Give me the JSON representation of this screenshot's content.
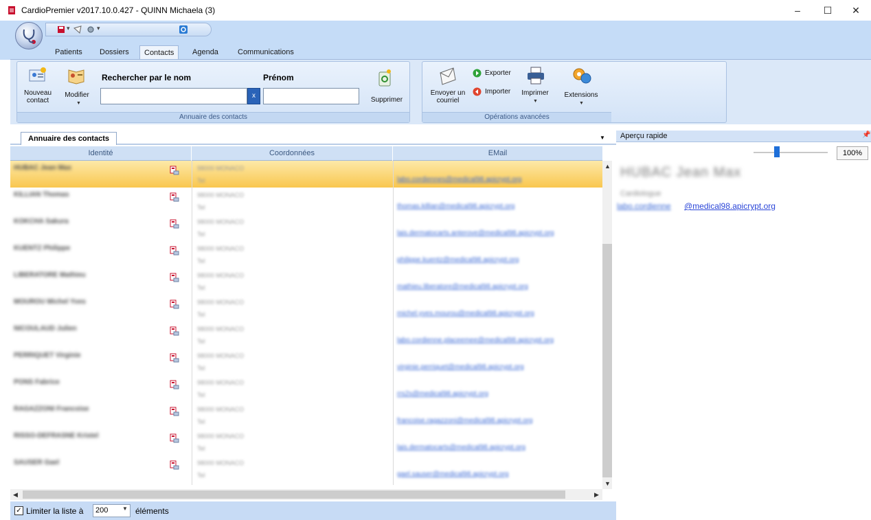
{
  "window": {
    "title": "CardioPremier v2017.10.0.427 - QUINN Michaela (3)",
    "minimize": "–",
    "maximize": "☐",
    "close": "✕"
  },
  "ribbon": {
    "tabs": [
      "Patients",
      "Dossiers",
      "Contacts",
      "Agenda",
      "Communications"
    ],
    "active_tab": "Contacts",
    "group_annuaire": {
      "label": "Annuaire des contacts",
      "nouveau_contact": "Nouveau contact",
      "modifier": "Modifier",
      "search_name_label": "Rechercher par le nom",
      "search_firstname_label": "Prénom",
      "search_name_value": "",
      "search_firstname_value": "",
      "clear": "x",
      "supprimer": "Supprimer"
    },
    "group_operations": {
      "label": "Opérations avancées",
      "envoyer_courriel": "Envoyer un courriel",
      "exporter": "Exporter",
      "importer": "Importer",
      "imprimer": "Imprimer",
      "extensions": "Extensions"
    }
  },
  "contacts_panel": {
    "tab_label": "Annuaire des contacts",
    "columns": [
      "Identité",
      "Coordonnées",
      "EMail"
    ],
    "rows": [
      {
        "name": "HUBAC Jean Max",
        "addr1": "98000 MONACO",
        "addr2": "Tel",
        "email": "labo.cordiennes@medical98.apicrypt.org",
        "selected": true
      },
      {
        "name": "KILLIAN Thomas",
        "addr1": "98000 MONACO",
        "addr2": "Tel",
        "email": "thomas.killian@medical98.apicrypt.org",
        "selected": false
      },
      {
        "name": "KOKCHA Sakura",
        "addr1": "98000 MONACO",
        "addr2": "Tel",
        "email": "lais.dermatocarts.anterove@medical98.apicrypt.org",
        "selected": false
      },
      {
        "name": "KUENTZ Philippe",
        "addr1": "98000 MONACO",
        "addr2": "Tel",
        "email": "philippe.kuentz@medical98.apicrypt.org",
        "selected": false
      },
      {
        "name": "LIBERATORE Mathieu",
        "addr1": "98000 MONACO",
        "addr2": "Tel",
        "email": "mathieu.liberatore@medical98.apicrypt.org",
        "selected": false
      },
      {
        "name": "MOUROU Michel Yves",
        "addr1": "98000 MONACO",
        "addr2": "Tel",
        "email": "michel.yves.mourou@medical98.apicrypt.org",
        "selected": false
      },
      {
        "name": "NICOULAUD Julien",
        "addr1": "98000 MONACO",
        "addr2": "Tel",
        "email": "labo.cordienne.placeemee@medical98.apicrypt.org",
        "selected": false
      },
      {
        "name": "PERRIQUET Virginie",
        "addr1": "98000 MONACO",
        "addr2": "Tel",
        "email": "virginie.perriquet@medical98.apicrypt.org",
        "selected": false
      },
      {
        "name": "PONS Fabrice",
        "addr1": "98000 MONACO",
        "addr2": "Tel",
        "email": "rrs2s@medical98.apicrypt.org",
        "selected": false
      },
      {
        "name": "RAGAZZONI Francoise",
        "addr1": "98000 MONACO",
        "addr2": "Tel",
        "email": "francoise.ragazzoni@medical98.apicrypt.org",
        "selected": false
      },
      {
        "name": "RISSO-DEFRASNE Kristel",
        "addr1": "98000 MONACO",
        "addr2": "Tel",
        "email": "lais.dermatocarts@medical98.apicrypt.org",
        "selected": false
      },
      {
        "name": "SAUSER Gael",
        "addr1": "98000 MONACO",
        "addr2": "Tel",
        "email": "gael.sauser@medical98.apicrypt.org",
        "selected": false
      }
    ],
    "footer": {
      "limit_label": "Limiter la liste à",
      "limit_value": "200",
      "limit_suffix": "éléments",
      "checked": true
    }
  },
  "preview_panel": {
    "title": "Aperçu rapide",
    "zoom": "100%",
    "zoom_level": 0.3,
    "name": "HUBAC Jean Max",
    "subtitle": "Cardiologue",
    "email_prefix": "labo.cordienne",
    "email_visible": "@medical98.apicrypt.org"
  },
  "colors": {
    "ribbon_bg": "#c5dcf7",
    "selected_row": "#f9c74f",
    "link": "#3d6bd6",
    "accent": "#1e6fd9"
  }
}
